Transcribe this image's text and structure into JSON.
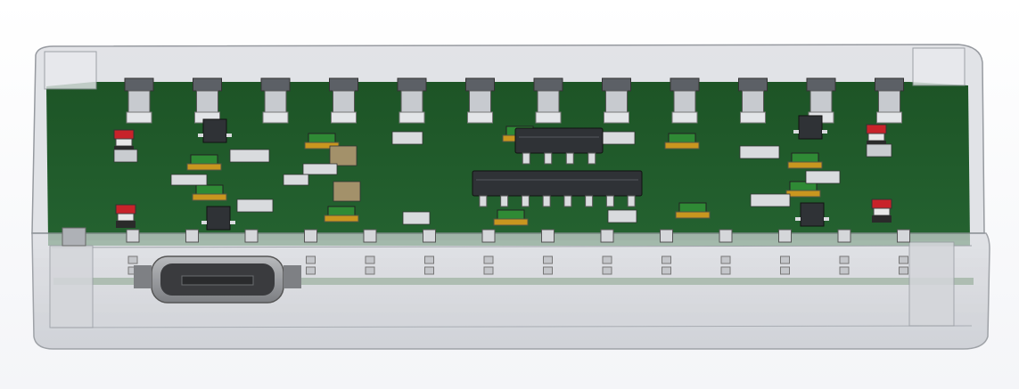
{
  "scene": {
    "subject": "pcb-assembly-in-transparent-enclosure",
    "colors": {
      "background": "#f3f4f7",
      "pcb": "#1f5a29",
      "pcb_edge": "#2e7238",
      "enclosure_glass": "#c9ccd2",
      "enclosure_edge": "#8c9096",
      "pin_header_body": "#5c6066",
      "pin_metal": "#c7cacf",
      "ic_body": "#2f3236",
      "ic_pin": "#d9dbde",
      "led_red": "#c8232a",
      "smd_gold": "#c9961f",
      "smd_green": "#2f8a35",
      "capacitor_tan": "#a3916a",
      "usb_metal": "#9a9ca0",
      "usb_dark": "#3a3b3e"
    },
    "icons": {
      "connector": "micro-usb-icon",
      "chip": "dip-ic-icon"
    },
    "counts": {
      "top_pin_headers": 12,
      "bottom_pins": 14,
      "dip_ics": 2,
      "red_leds": 4
    }
  }
}
